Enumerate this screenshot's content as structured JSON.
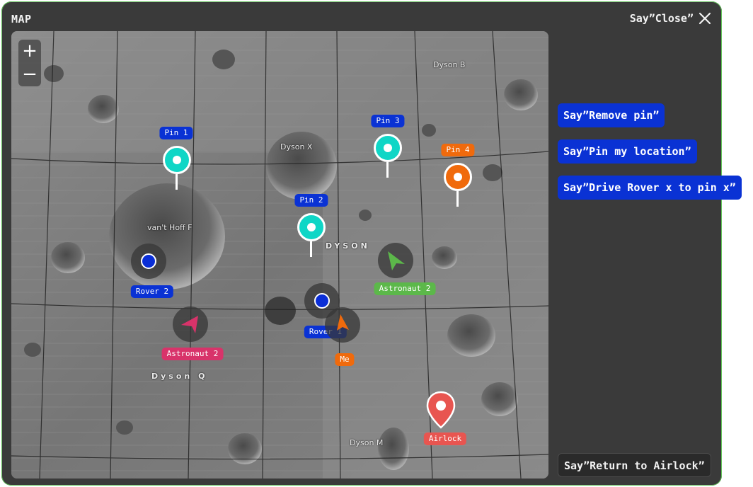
{
  "window": {
    "title": "MAP",
    "close_label": "Say”Close”"
  },
  "zoom": {
    "in_label": "+",
    "out_label": "−"
  },
  "map_labels": {
    "dyson_b": "Dyson B",
    "dyson_x": "Dyson X",
    "vant_hoff_f": "van't Hoff F",
    "dyson": "DYSON",
    "dyson_q": "Dyson Q",
    "dyson_m": "Dyson M"
  },
  "pins": [
    {
      "label": "Pin 1",
      "color": "#0fd6c6"
    },
    {
      "label": "Pin 2",
      "color": "#0fd6c6"
    },
    {
      "label": "Pin 3",
      "color": "#0fd6c6"
    },
    {
      "label": "Pin 4",
      "color": "#f06a0c"
    }
  ],
  "units": {
    "rover_1": "Rover 1",
    "rover_2": "Rover 2",
    "astronaut_2_green": "Astronaut 2",
    "astronaut_2_pink": "Astronaut 2",
    "me": "Me",
    "airlock": "Airlock"
  },
  "commands": {
    "remove_pin": "Say”Remove pin”",
    "pin_location": "Say”Pin my location”",
    "drive_rover": "Say”Drive Rover x to pin x”",
    "return_airlock": "Say”Return to Airlock”"
  },
  "colors": {
    "panel_bg": "#3a3a3a",
    "accent_blue": "#0a32d4",
    "pin_teal": "#0fd6c6",
    "pin_orange": "#f06a0c",
    "astronaut_green": "#5cb84a",
    "astronaut_pink": "#d8336a",
    "airlock_red": "#e85550"
  }
}
